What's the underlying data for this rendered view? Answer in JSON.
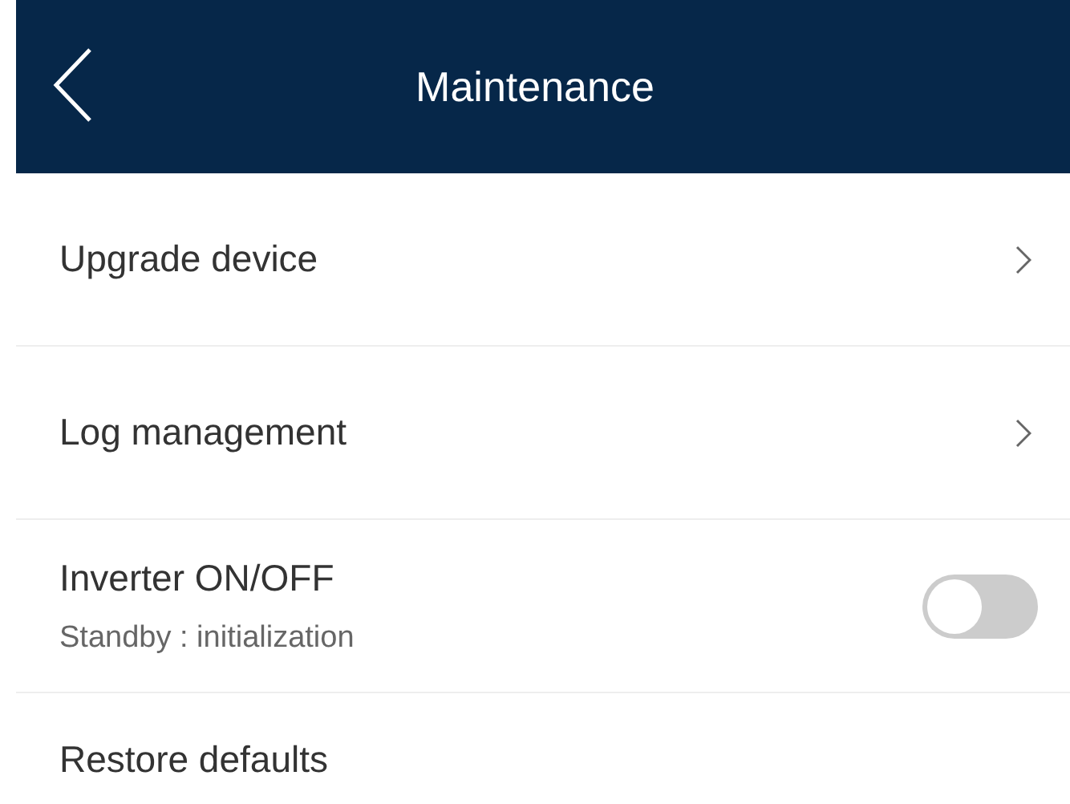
{
  "header": {
    "title": "Maintenance"
  },
  "items": [
    {
      "kind": "link",
      "label": "Upgrade device"
    },
    {
      "kind": "link",
      "label": "Log management"
    },
    {
      "kind": "toggle",
      "label": "Inverter ON/OFF",
      "subtitle": "Standby : initialization",
      "on": false
    },
    {
      "kind": "plain",
      "label": "Restore defaults"
    }
  ]
}
